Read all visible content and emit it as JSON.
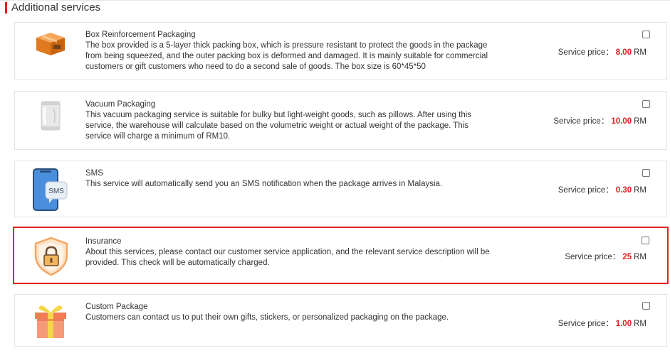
{
  "section": {
    "title": "Additional services"
  },
  "price_label": "Service price：",
  "currency": "RM",
  "accent_color": "#e02020",
  "selected_border_color": "#e42323",
  "services": [
    {
      "name": "Box Reinforcement Packaging",
      "description": "The box provided is a 5-layer thick packing box, which is pressure resistant to protect the goods in the package from being squeezed, and the outer packing box is deformed and damaged. It is mainly suitable for commercial customers or gift customers who need to do a second sale of goods. The box size is 60*45*50",
      "price": "8.00",
      "icon": "box-icon",
      "checked": false
    },
    {
      "name": "Vacuum Packaging",
      "description": "This vacuum packaging service is suitable for bulky but light-weight goods, such as pillows. After using this service, the warehouse will calculate based on the volumetric weight or actual weight of the package. This service will charge a minimum of RM10.",
      "price": "10.00",
      "icon": "vacuum-bag-icon",
      "checked": false
    },
    {
      "name": "SMS",
      "description": "This service will automatically send you an SMS notification when the package arrives in Malaysia.",
      "price": "0.30",
      "icon": "phone-sms-icon",
      "icon_text": "SMS",
      "checked": false
    },
    {
      "name": "Insurance",
      "description": "About this services, please contact our customer service application, and the relevant service description will be provided. This check will be automatically charged.",
      "price": "25",
      "icon": "shield-lock-icon",
      "checked": false,
      "highlighted": true
    },
    {
      "name": "Custom Package",
      "description": "Customers can contact us to put their own gifts, stickers, or personalized packaging on the package.",
      "price": "1.00",
      "icon": "gift-icon",
      "checked": false
    }
  ]
}
